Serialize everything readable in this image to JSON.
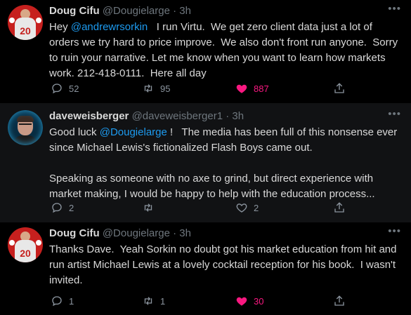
{
  "colors": {
    "background": "#000000",
    "highlight": "#111214",
    "mention": "#1d9bf0",
    "like_active": "#f91880",
    "secondary": "#6e767d"
  },
  "tweets": [
    {
      "name": "Doug Cifu",
      "handle": "@Dougielarge",
      "dot": "·",
      "time": "3h",
      "more": "•••",
      "text_parts": [
        "Hey ",
        "@andrewrsorkin",
        "   I run Virtu.  We get zero client data just a lot of orders we try hard to price improve.  We also don't front run anyone.  Sorry to ruin your narrative. Let me know when you want to learn how markets work. 212-418-0111.  Here all day"
      ],
      "avatar": {
        "number": "20"
      },
      "replies": "52",
      "retweets": "95",
      "likes": "887",
      "liked": true
    },
    {
      "name": "daveweisberger",
      "handle": "@daveweisberger1",
      "dot": "·",
      "time": "3h",
      "more": "•••",
      "text_parts": [
        "Good luck ",
        "@Dougielarge",
        " !   The media has been full of this nonsense ever since Michael Lewis's fictionalized Flash Boys came out.\n\nSpeaking as someone with no axe to grind, but direct experience with market making, I would be happy to help with the education process..."
      ],
      "replies": "2",
      "retweets": "",
      "likes": "2",
      "liked": false
    },
    {
      "name": "Doug Cifu",
      "handle": "@Dougielarge",
      "dot": "·",
      "time": "3h",
      "more": "•••",
      "text_parts": [
        "Thanks Dave.  Yeah Sorkin no doubt got his market education from hit and run artist Michael Lewis at a lovely cocktail reception for his book.  I wasn't invited."
      ],
      "avatar": {
        "number": "20"
      },
      "replies": "1",
      "retweets": "1",
      "likes": "30",
      "liked": true
    }
  ]
}
